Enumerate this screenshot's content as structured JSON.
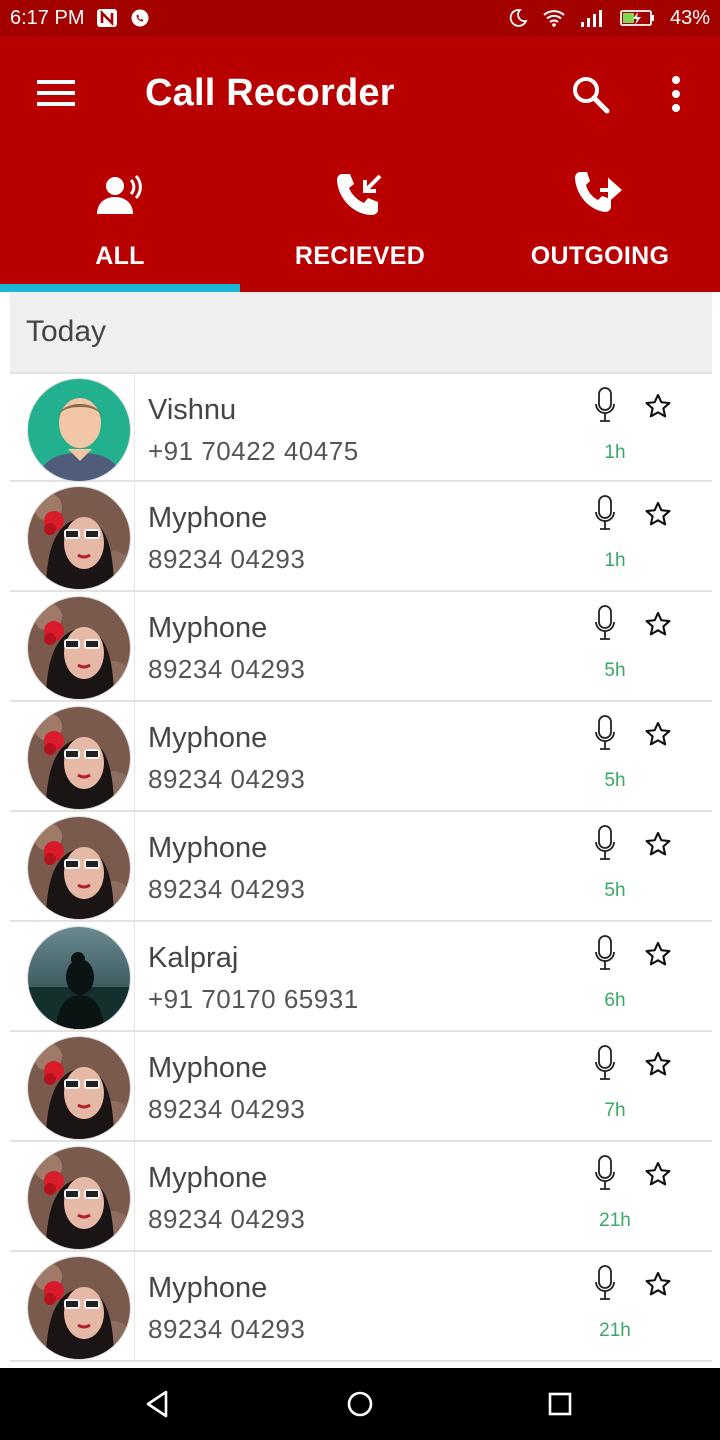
{
  "status_bar": {
    "time": "6:17 PM",
    "battery": "43%",
    "icons": [
      "notification-n-icon",
      "whatsapp-icon",
      "dnd-moon-icon",
      "wifi-icon",
      "signal-icon",
      "battery-charging-icon"
    ]
  },
  "toolbar": {
    "title": "Call Recorder",
    "menu_icon": "hamburger-menu-icon",
    "search_icon": "search-icon",
    "more_icon": "more-vertical-icon"
  },
  "tabs": [
    {
      "label": "ALL",
      "icon": "people-voice-icon",
      "selected": true
    },
    {
      "label": "RECIEVED",
      "icon": "incoming-call-icon",
      "selected": false
    },
    {
      "label": "OUTGOING",
      "icon": "outgoing-call-icon",
      "selected": false
    }
  ],
  "list": {
    "section_header": "Today",
    "items": [
      {
        "name": "Vishnu",
        "number": "+91 70422 40475",
        "time": "1h",
        "avatar": "default-person"
      },
      {
        "name": "Myphone",
        "number": "89234 04293",
        "time": "1h",
        "avatar": "photo-woman-sunglasses"
      },
      {
        "name": "Myphone",
        "number": "89234 04293",
        "time": "5h",
        "avatar": "photo-woman-sunglasses"
      },
      {
        "name": "Myphone",
        "number": "89234 04293",
        "time": "5h",
        "avatar": "photo-woman-sunglasses"
      },
      {
        "name": "Myphone",
        "number": "89234 04293",
        "time": "5h",
        "avatar": "photo-woman-sunglasses"
      },
      {
        "name": "Kalpraj",
        "number": "+91 70170 65931",
        "time": "6h",
        "avatar": "photo-silhouette-sea"
      },
      {
        "name": "Myphone",
        "number": "89234 04293",
        "time": "7h",
        "avatar": "photo-woman-sunglasses"
      },
      {
        "name": "Myphone",
        "number": "89234 04293",
        "time": "21h",
        "avatar": "photo-woman-sunglasses"
      },
      {
        "name": "Myphone",
        "number": "89234 04293",
        "time": "21h",
        "avatar": "photo-woman-sunglasses"
      }
    ]
  },
  "colors": {
    "status_bar": "#a30000",
    "app_bar": "#b80000",
    "tab_indicator": "#1bb8d6",
    "time_text": "#3aa866",
    "section_header_bg": "#efefef"
  },
  "nav_bar": {
    "back_icon": "back-triangle-icon",
    "home_icon": "home-circle-icon",
    "recents_icon": "recents-square-icon"
  }
}
